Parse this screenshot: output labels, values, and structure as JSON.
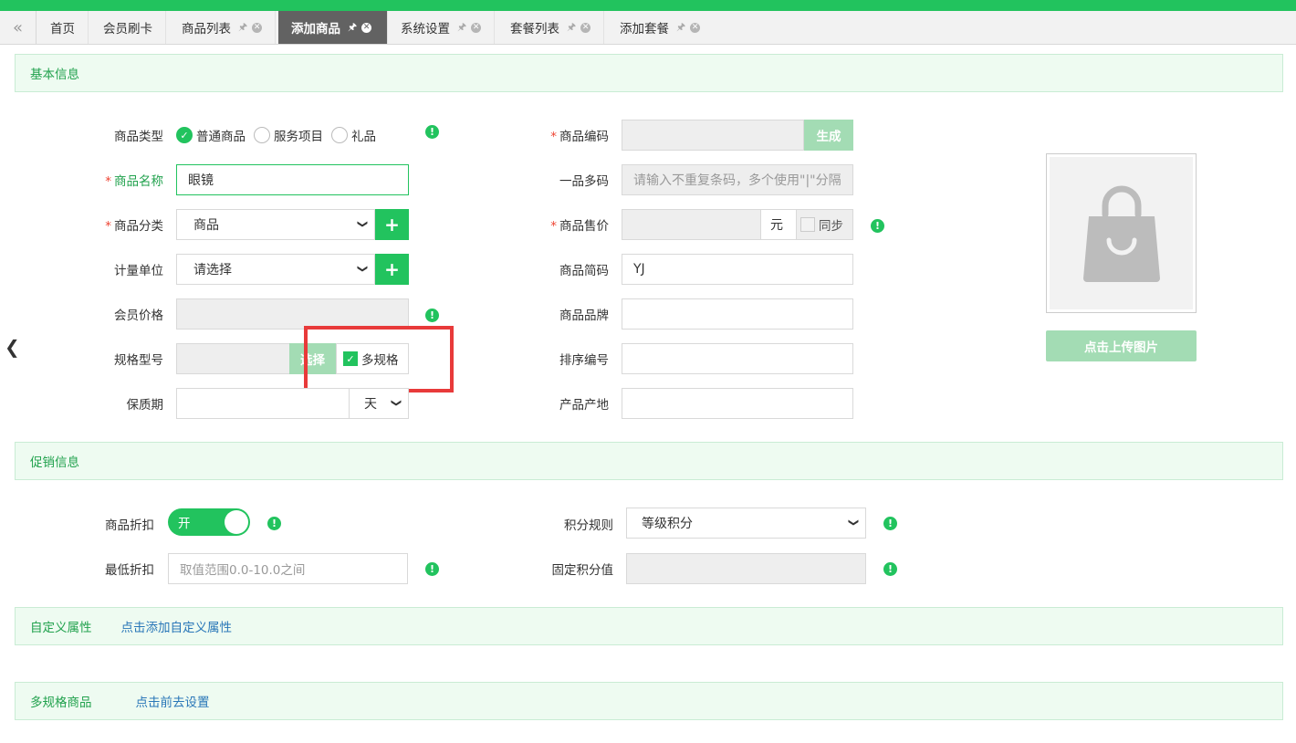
{
  "tabs": [
    {
      "label": "首页",
      "active": false,
      "closable": false
    },
    {
      "label": "会员刷卡",
      "active": false,
      "closable": false
    },
    {
      "label": "商品列表",
      "active": false,
      "closable": true
    },
    {
      "label": "添加商品",
      "active": true,
      "closable": true
    },
    {
      "label": "系统设置",
      "active": false,
      "closable": true
    },
    {
      "label": "套餐列表",
      "active": false,
      "closable": true
    },
    {
      "label": "添加套餐",
      "active": false,
      "closable": true
    }
  ],
  "sections": {
    "basic": "基本信息",
    "promo": "促销信息",
    "custom": "自定义属性",
    "custom_link": "点击添加自定义属性",
    "multispec": "多规格商品",
    "multispec_link": "点击前去设置"
  },
  "basic": {
    "type_label": "商品类型",
    "type_options": [
      "普通商品",
      "服务项目",
      "礼品"
    ],
    "type_selected": "普通商品",
    "name_label": "商品名称",
    "name_value": "眼镜",
    "category_label": "商品分类",
    "category_value": "商品",
    "unit_label": "计量单位",
    "unit_value": "请选择",
    "member_price_label": "会员价格",
    "spec_label": "规格型号",
    "spec_select_btn": "选择",
    "multi_spec_label": "多规格",
    "shelf_label": "保质期",
    "shelf_unit": "天",
    "code_label": "商品编码",
    "code_gen_btn": "生成",
    "multi_code_label": "一品多码",
    "multi_code_placeholder": "请输入不重复条码，多个使用\"|\"分隔",
    "sale_price_label": "商品售价",
    "sale_price_unit": "元",
    "sync_label": "同步",
    "short_code_label": "商品简码",
    "short_code_value": "YJ",
    "brand_label": "商品品牌",
    "sort_label": "排序编号",
    "origin_label": "产品产地",
    "upload_btn": "点击上传图片"
  },
  "promo": {
    "discount_label": "商品折扣",
    "discount_toggle": "开",
    "min_discount_label": "最低折扣",
    "min_discount_placeholder": "取值范围0.0-10.0之间",
    "points_rule_label": "积分规则",
    "points_rule_value": "等级积分",
    "fixed_points_label": "固定积分值"
  },
  "colors": {
    "accent": "#22c35e",
    "link": "#2a77b8",
    "highlight": "#e83a3a"
  }
}
